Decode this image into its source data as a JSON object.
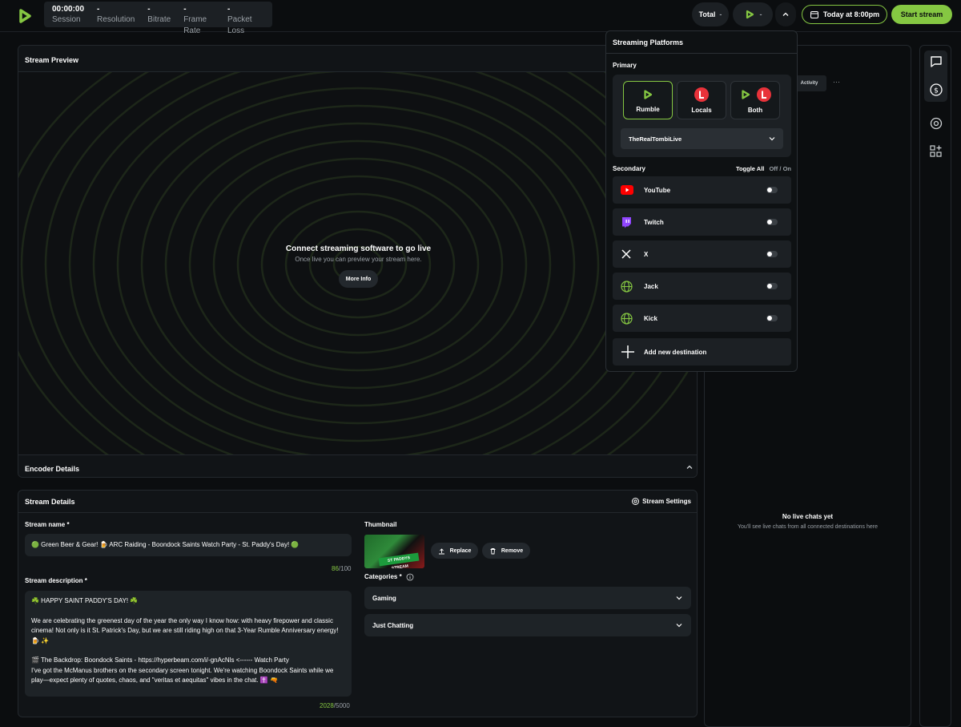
{
  "topbar": {
    "stats": [
      {
        "value": "00:00:00",
        "label": "Session"
      },
      {
        "value": "-",
        "label": "Resolution"
      },
      {
        "value": "-",
        "label": "Bitrate"
      },
      {
        "value": "-",
        "label": "Frame Rate"
      },
      {
        "value": "-",
        "label": "Packet Loss"
      }
    ],
    "total_label": "Total",
    "total_value": "-",
    "platform_value": "-",
    "schedule_label": "Today at 8:00pm",
    "start_label": "Start stream"
  },
  "preview": {
    "title": "Stream Preview",
    "heading": "Connect streaming software to go live",
    "subtext": "Once live you can preview your stream here.",
    "more_info": "More Info",
    "encoder_title": "Encoder Details"
  },
  "details": {
    "title": "Stream Details",
    "settings_label": "Stream Settings",
    "name_label": "Stream name *",
    "name_value": "🟢 Green Beer & Gear! 🍺 ARC Raiding - Boondock Saints Watch Party - St. Paddy's Day! 🟢",
    "name_count": "86",
    "name_max": "/100",
    "desc_label": "Stream description *",
    "desc_line1": "☘️ HAPPY SAINT PADDY'S DAY! ☘️",
    "desc_line2": "We are celebrating the greenest day of the year the only way I know how: with heavy firepower and classic cinema! Not only is it St. Patrick's Day, but we are still riding high on that 3-Year Rumble Anniversary energy! 🍺 ✨",
    "desc_line3": "🎬 The Backdrop: Boondock Saints - https://hyperbeam.com/i/-gnAcNls  <------ Watch Party",
    "desc_line4": "I've got the McManus brothers on the secondary screen tonight. We're watching Boondock Saints while we play—expect plenty of quotes, chaos, and \"veritas et aequitas\" vibes in the chat. ✝️ 🔫",
    "desc_count": "2028",
    "desc_max": "/5000",
    "thumb_label": "Thumbnail",
    "thumb_caption": "ST PADDYS STREAM",
    "replace_label": "Replace",
    "remove_label": "Remove",
    "categories_label": "Categories *",
    "category_1": "Gaming",
    "category_2": "Just Chatting"
  },
  "platforms": {
    "title": "Streaming Platforms",
    "primary_label": "Primary",
    "cards": [
      {
        "label": "Rumble"
      },
      {
        "label": "Locals"
      },
      {
        "label": "Both"
      }
    ],
    "account": "TheRealTombiLive",
    "secondary_label": "Secondary",
    "toggle_all": "Toggle All",
    "off": "Off",
    "slash": " / ",
    "on": "On",
    "secondary": [
      {
        "label": "YouTube"
      },
      {
        "label": "Twitch"
      },
      {
        "label": "X"
      },
      {
        "label": "Jack"
      },
      {
        "label": "Kick"
      }
    ],
    "add_label": "Add new destination"
  },
  "chat": {
    "activity_tab": "Activity",
    "more": "···",
    "empty_title": "No live chats yet",
    "empty_sub": "You'll see live chats from all connected destinations here"
  },
  "colors": {
    "accent": "#85c742",
    "rumble_red": "#e8323a",
    "youtube_red": "#ff0000",
    "twitch_purple": "#9146ff"
  }
}
